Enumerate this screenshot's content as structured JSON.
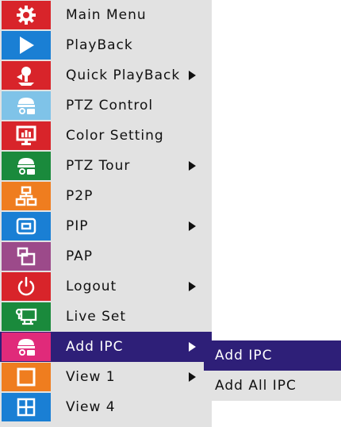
{
  "menu": {
    "items": [
      {
        "label": "Main Menu",
        "icon": "gear-icon",
        "color": "#d8242a",
        "submenu": false
      },
      {
        "label": "PlayBack",
        "icon": "play-icon",
        "color": "#1a7fd4",
        "submenu": false
      },
      {
        "label": "Quick PlayBack",
        "icon": "quick-playback-icon",
        "color": "#d8242a",
        "submenu": true
      },
      {
        "label": "PTZ Control",
        "icon": "ptz-camera-icon",
        "color": "#7fc3e8",
        "submenu": false
      },
      {
        "label": "Color Setting",
        "icon": "monitor-chart-icon",
        "color": "#d8242a",
        "submenu": false
      },
      {
        "label": "PTZ Tour",
        "icon": "ptz-camera-icon",
        "color": "#1a8a3c",
        "submenu": true
      },
      {
        "label": "P2P",
        "icon": "network-icon",
        "color": "#ef7d1f",
        "submenu": false
      },
      {
        "label": "PIP",
        "icon": "pip-icon",
        "color": "#1a7fd4",
        "submenu": true
      },
      {
        "label": "PAP",
        "icon": "pap-icon",
        "color": "#9c4a8a",
        "submenu": false
      },
      {
        "label": "Logout",
        "icon": "power-icon",
        "color": "#d8242a",
        "submenu": true
      },
      {
        "label": "Live Set",
        "icon": "live-set-icon",
        "color": "#1a8a3c",
        "submenu": false
      },
      {
        "label": "Add IPC",
        "icon": "ip-camera-icon",
        "color": "#e02a7a",
        "submenu": true,
        "selected": true
      },
      {
        "label": "View 1",
        "icon": "view-single-icon",
        "color": "#ef7d1f",
        "submenu": true
      },
      {
        "label": "View 4",
        "icon": "view-quad-icon",
        "color": "#1a7fd4",
        "submenu": false
      }
    ]
  },
  "submenu": {
    "items": [
      {
        "label": "Add IPC",
        "selected": true
      },
      {
        "label": "Add All IPC",
        "selected": false
      }
    ]
  },
  "colors": {
    "menu_bg": "#e2e2e2",
    "selected_bg": "#2e1f78"
  }
}
